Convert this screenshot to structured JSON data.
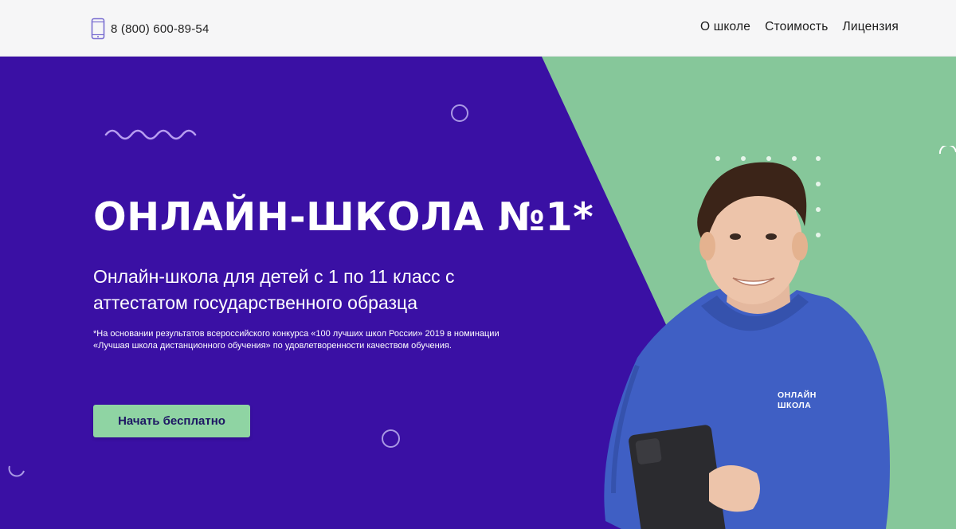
{
  "header": {
    "phone": "8 (800) 600-89-54",
    "phone_icon": "phone-icon",
    "nav": [
      {
        "label": "О школе"
      },
      {
        "label": "Стоимость"
      },
      {
        "label": "Лицензия"
      }
    ]
  },
  "hero": {
    "title": "ОНЛАЙН-ШКОЛА №1*",
    "subtitle": "Онлайн-школа для детей с 1 по 11 класс с аттестатом государственного образца",
    "footnote": "*На основании результатов всероссийского конкурса «100 лучших школ России» 2019 в номинации «Лучшая школа дистанционного обучения» по удовлетворенности качеством обучения.",
    "cta_label": "Начать бесплатно",
    "hoodie_line1": "ОНЛАЙН",
    "hoodie_line2": "ШКОЛА"
  },
  "colors": {
    "purple": "#3a10a4",
    "green": "#86c79a",
    "button": "#8fd4a3",
    "hoodie": "#3f5fc4"
  }
}
